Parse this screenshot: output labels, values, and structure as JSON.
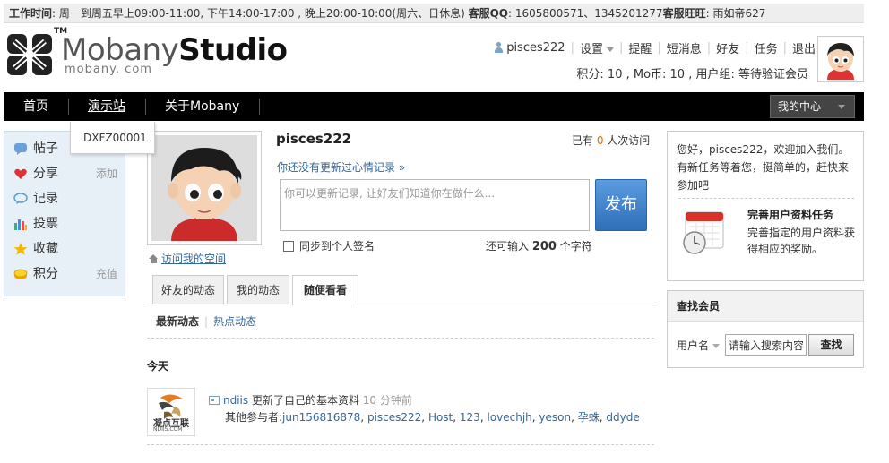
{
  "topbar": {
    "label1": "工作时间",
    "text1": ": 周一到周五早上09:00-11:00, 下午14:00-17:00 , 晚上20:00-10:00(周六、日休息) ",
    "label2": "客服QQ",
    "text2": ": 1605800571、1345201277",
    "label3": "客服旺旺",
    "text3": ": 雨如帝627"
  },
  "logo": {
    "tm": "TM",
    "part1": "Mobany",
    "part2": "Studio",
    "sub": "mobany. com"
  },
  "usernav": {
    "username": "pisces222",
    "items": [
      "设置",
      "提醒",
      "短消息",
      "好友",
      "任务",
      "退出"
    ]
  },
  "userstats": "积分: 10 , Mo币: 10 , 用户组: 等待验证会员",
  "navbar": {
    "items": [
      "首页",
      "演示站",
      "关于Mobany"
    ],
    "my_center": "我的中心"
  },
  "dropdown": {
    "item": "DXFZ00001"
  },
  "sidebar": {
    "items": [
      {
        "label": "帖子",
        "action": ""
      },
      {
        "label": "分享",
        "action": "添加"
      },
      {
        "label": "记录",
        "action": ""
      },
      {
        "label": "投票",
        "action": ""
      },
      {
        "label": "收藏",
        "action": ""
      },
      {
        "label": "积分",
        "action": "充值"
      }
    ]
  },
  "profile": {
    "name": "pisces222",
    "visits_prefix": "已有 ",
    "visits_count": "0",
    "visits_suffix": " 人次访问",
    "mood_link": "你还没有更新过心情记录 »",
    "mood_placeholder": "你可以更新记录, 让好友们知道你在做什么...",
    "publish": "发布",
    "sync_label": "同步到个人签名",
    "char_prefix": "还可输入 ",
    "char_count": "200",
    "char_suffix": " 个字符",
    "visit_space": "访问我的空间"
  },
  "tabs": [
    "好友的动态",
    "我的动态",
    "随便看看"
  ],
  "subtabs": {
    "current": "最新动态",
    "other": "热点动态"
  },
  "today": "今天",
  "feed": {
    "logo_text": "凝点互联",
    "logo_sub": "NDIIS.COM",
    "user": "ndiis",
    "action": " 更新了自己的基本资料 ",
    "time": "10 分钟前",
    "others_label": "其他参与者:",
    "others": [
      "jun156816878",
      "pisces222",
      "Host",
      "123",
      "lovechjh",
      "yeson",
      "孕蛛",
      "ddyde"
    ]
  },
  "welcome": {
    "text": "您好，pisces222，欢迎加入我们。有新任务等着您，挺简单的，赶快来参加吧",
    "task_title": "完善用户资料任务",
    "task_desc": "完善指定的用户资料获得相应的奖励。"
  },
  "search": {
    "title": "查找会员",
    "label": "用户名",
    "placeholder": "请输入搜索内容",
    "button": "查找"
  },
  "colors": {
    "accent_blue": "#336699",
    "publish_blue": "#3a7dc8",
    "nav_bg": "#000000",
    "sidebar_bg": "#e8f0f7"
  }
}
